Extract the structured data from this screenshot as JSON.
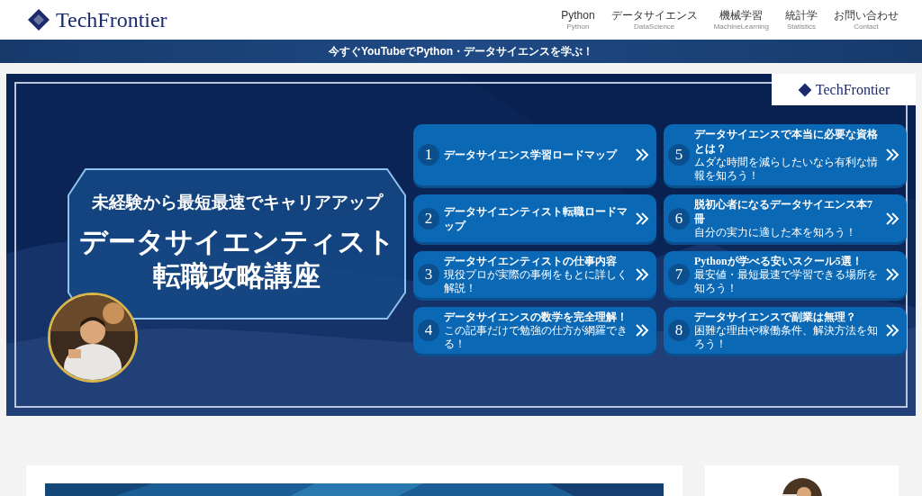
{
  "header": {
    "logo": "TechFrontier",
    "nav": [
      {
        "label": "Python",
        "sub": "Python"
      },
      {
        "label": "データサイエンス",
        "sub": "DataScience"
      },
      {
        "label": "機械学習",
        "sub": "MachineLearning"
      },
      {
        "label": "統計学",
        "sub": "Statistics"
      },
      {
        "label": "お問い合わせ",
        "sub": "Contact"
      }
    ]
  },
  "announcement": "今すぐYouTubeでPython・データサイエンスを学ぶ！",
  "banner": {
    "logo": "TechFrontier",
    "tagline": "未経験から最短最速でキャリアアップ",
    "title_lines": [
      "データサイエンティスト",
      "転職攻略講座"
    ],
    "links": [
      {
        "number": "1",
        "title": "データサイエンス学習ロードマップ"
      },
      {
        "number": "2",
        "title": "データサイエンティスト転職ロードマップ"
      },
      {
        "number": "3",
        "title": "データサイエンティストの仕事内容",
        "subtitle": "現役プロが実際の事例をもとに詳しく解説！"
      },
      {
        "number": "4",
        "title": "データサイエンスの数学を完全理解！",
        "subtitle": "この記事だけで勉強の仕方が網羅できる！"
      },
      {
        "number": "5",
        "title": "データサイエンスで本当に必要な資格とは？",
        "subtitle": "ムダな時間を減らしたいなら有利な情報を知ろう！"
      },
      {
        "number": "6",
        "title": "脱初心者になるデータサイエンス本7冊",
        "subtitle": "自分の実力に適した本を知ろう！"
      },
      {
        "number": "7",
        "title": "Pythonが学べる安いスクール5選！",
        "subtitle": "最安値・最短最速で学習できる場所を知ろう！"
      },
      {
        "number": "8",
        "title": "データサイエンスで副業は無理？",
        "subtitle": "困難な理由や稼働条件、解決方法を知ろう！"
      }
    ]
  }
}
